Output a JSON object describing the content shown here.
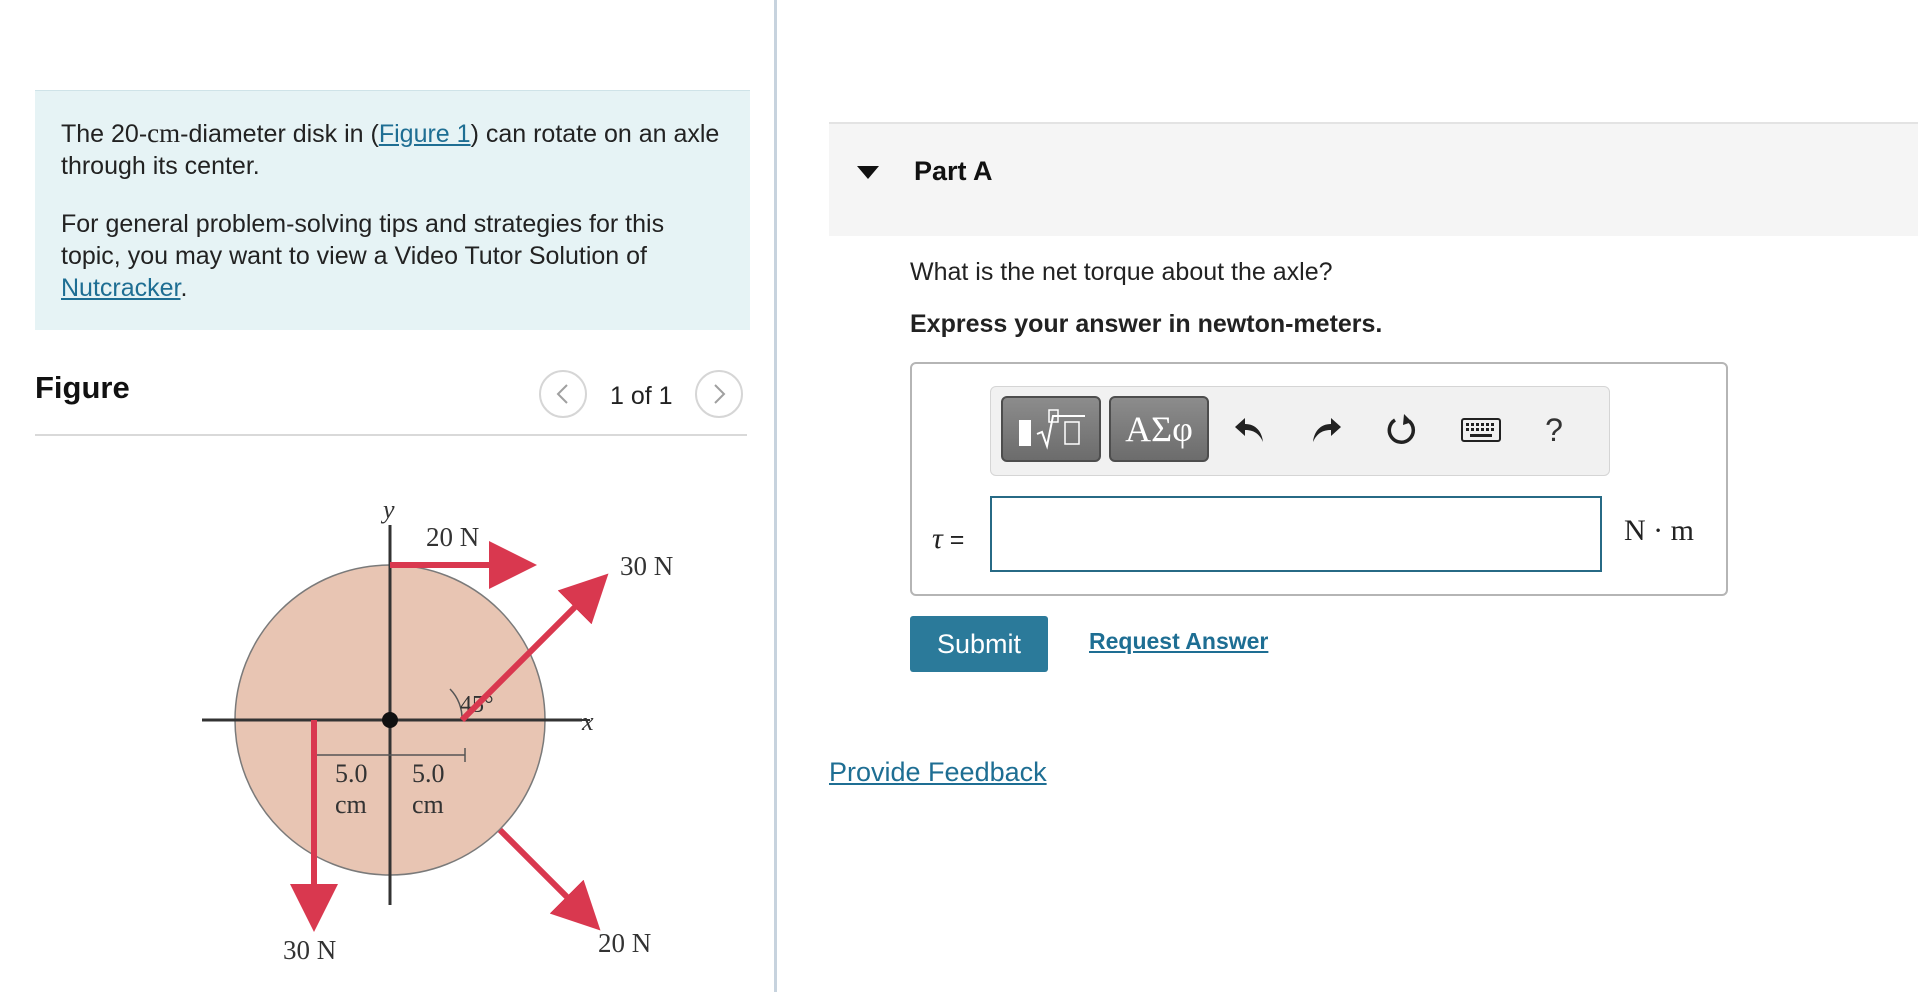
{
  "intro": {
    "p1_before": "The 20-",
    "p1_unit": "cm",
    "p1_middle": "-diameter disk in (",
    "p1_link": "Figure 1",
    "p1_after": ") can rotate on an axle through its center.",
    "p2_text": "For general problem-solving tips and strategies for this topic, you may want to view a Video Tutor Solution of ",
    "p2_link": "Nutcracker",
    "p2_end": "."
  },
  "figure": {
    "title": "Figure",
    "pager": "1 of 1",
    "prev_icon": "chevron-left-icon",
    "next_icon": "chevron-right-icon",
    "labels": {
      "y_axis": "y",
      "x_axis": "x",
      "top_force": "20 N",
      "upper_right_force": "30 N",
      "angle": "45°",
      "dist_left_value": "5.0",
      "dist_left_unit": "cm",
      "dist_right_value": "5.0",
      "dist_right_unit": "cm",
      "bottom_left_force": "30 N",
      "bottom_right_force": "20 N"
    },
    "colors": {
      "disk_fill": "#e8c5b3",
      "arrow": "#d9384f"
    }
  },
  "part": {
    "title": "Part A",
    "question": "What is the net torque about the axle?",
    "instruction": "Express your answer in newton-meters.",
    "toolbar": {
      "template_icon": "template-radical-icon",
      "greek_label": "ΑΣφ",
      "undo_icon": "undo-icon",
      "redo_icon": "redo-icon",
      "reset_icon": "reset-icon",
      "keyboard_icon": "keyboard-icon",
      "help_label": "?"
    },
    "answer": {
      "variable": "τ",
      "equals": " =",
      "value": "",
      "unit": "N · m"
    },
    "submit_label": "Submit",
    "request_label": "Request Answer"
  },
  "feedback_label": "Provide Feedback",
  "colors": {
    "accent": "#2b7a9a",
    "link": "#1e6e93",
    "intro_bg": "#e6f3f5"
  }
}
